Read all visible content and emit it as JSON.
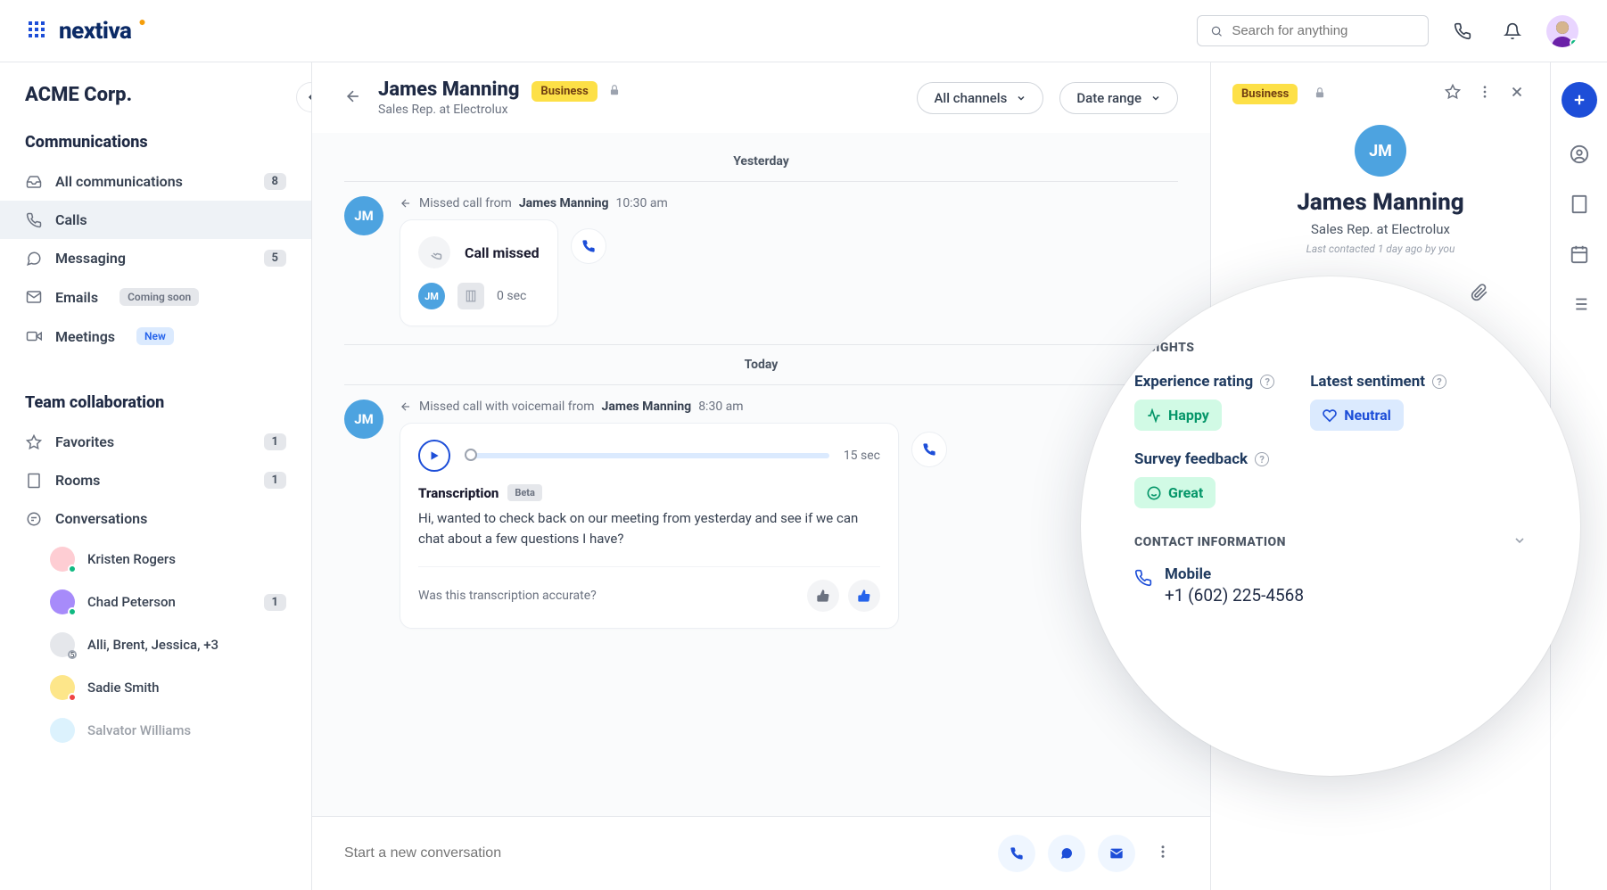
{
  "logo": "nextiva",
  "search": {
    "placeholder": "Search for anything"
  },
  "sidebar": {
    "org": "ACME Corp.",
    "sections": {
      "communications": {
        "title": "Communications",
        "items": [
          {
            "label": "All communications",
            "badge": "8"
          },
          {
            "label": "Calls"
          },
          {
            "label": "Messaging",
            "badge": "5"
          },
          {
            "label": "Emails",
            "tag": "Coming soon"
          },
          {
            "label": "Meetings",
            "tag": "New"
          }
        ]
      },
      "team": {
        "title": "Team collaboration",
        "items": [
          {
            "label": "Favorites",
            "badge": "1"
          },
          {
            "label": "Rooms",
            "badge": "1"
          },
          {
            "label": "Conversations"
          }
        ],
        "conversations": [
          {
            "name": "Kristen Rogers"
          },
          {
            "name": "Chad Peterson",
            "badge": "1"
          },
          {
            "name": "Alli, Brent, Jessica, +3"
          },
          {
            "name": "Sadie Smith"
          },
          {
            "name": "Salvator Williams"
          }
        ]
      }
    }
  },
  "main": {
    "contact": {
      "name": "James Manning",
      "role": "Sales Rep. at Electrolux",
      "chip": "Business"
    },
    "filters": {
      "channel": "All channels",
      "date": "Date range"
    },
    "timeline": {
      "yesterday": {
        "label": "Yesterday",
        "item": {
          "initials": "JM",
          "prefix": "Missed call from",
          "name": "James Manning",
          "time": "10:30 am",
          "title": "Call missed",
          "duration": "0 sec"
        }
      },
      "today": {
        "label": "Today",
        "item": {
          "initials": "JM",
          "prefix": "Missed call with voicemail from",
          "name": "James Manning",
          "time": "8:30 am",
          "duration": "15 sec",
          "transcription_title": "Transcription",
          "transcription_tag": "Beta",
          "transcription_text": "Hi, wanted to check back on our meeting from yesterday and see if we can chat about a few questions I have?",
          "feedback_q": "Was this transcription accurate?"
        }
      }
    },
    "composer": {
      "placeholder": "Start a new conversation"
    }
  },
  "right": {
    "chip": "Business",
    "initials": "JM",
    "name": "James Manning",
    "role": "Sales Rep. at Electrolux",
    "meta": "Last contacted 1 day ago by you"
  },
  "insights": {
    "title": "INSIGHTS",
    "experience": {
      "label": "Experience rating",
      "value": "Happy"
    },
    "sentiment": {
      "label": "Latest sentiment",
      "value": "Neutral"
    },
    "survey": {
      "label": "Survey feedback",
      "value": "Great"
    },
    "contact_title": "CONTACT INFORMATION",
    "mobile": {
      "label": "Mobile",
      "value": "+1 (602) 225-4568"
    }
  }
}
